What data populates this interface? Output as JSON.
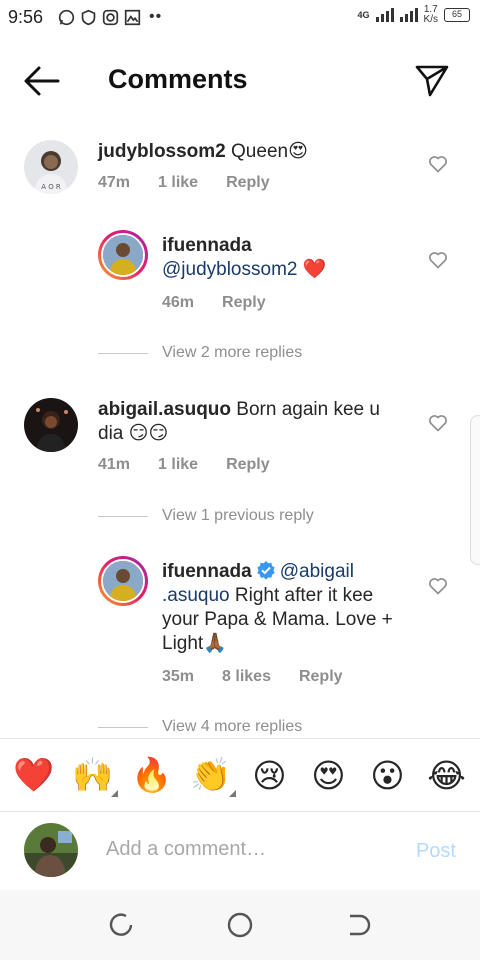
{
  "status": {
    "time": "9:56",
    "network": "4G",
    "speed_value": "1.7",
    "speed_unit": "K/s",
    "battery": "65"
  },
  "header": {
    "title": "Comments"
  },
  "comments": [
    {
      "username": "judyblossom2",
      "text": " Queen😍",
      "time": "47m",
      "likes": "1 like",
      "reply": "Reply"
    },
    {
      "username": "ifuennada",
      "mention": "@judyblossom2",
      "text": " ❤️",
      "time": "46m",
      "reply": "Reply"
    },
    {
      "username": "abigail.asuquo",
      "text": " Born again kee u dia 😏😏",
      "time": "41m",
      "likes": "1 like",
      "reply": "Reply"
    },
    {
      "username": "ifuennada",
      "mention": "@abigail .asuquo",
      "text": " Right after it kee your Papa & Mama. Love + Light🙏🏾",
      "time": "35m",
      "likes": "8 likes",
      "reply": "Reply"
    }
  ],
  "view_more": [
    "View 2 more replies",
    "View 1 previous reply",
    "View 4 more replies"
  ],
  "emojis": [
    "❤️",
    "🙌",
    "🔥",
    "👏",
    "😢",
    "😍",
    "😮",
    "😂"
  ],
  "add_comment": {
    "placeholder": "Add a comment…",
    "post_label": "Post"
  },
  "colors": {
    "accent_link": "#1a3a6b",
    "post_disabled": "#b3dbff",
    "verified": "#3897f0"
  }
}
